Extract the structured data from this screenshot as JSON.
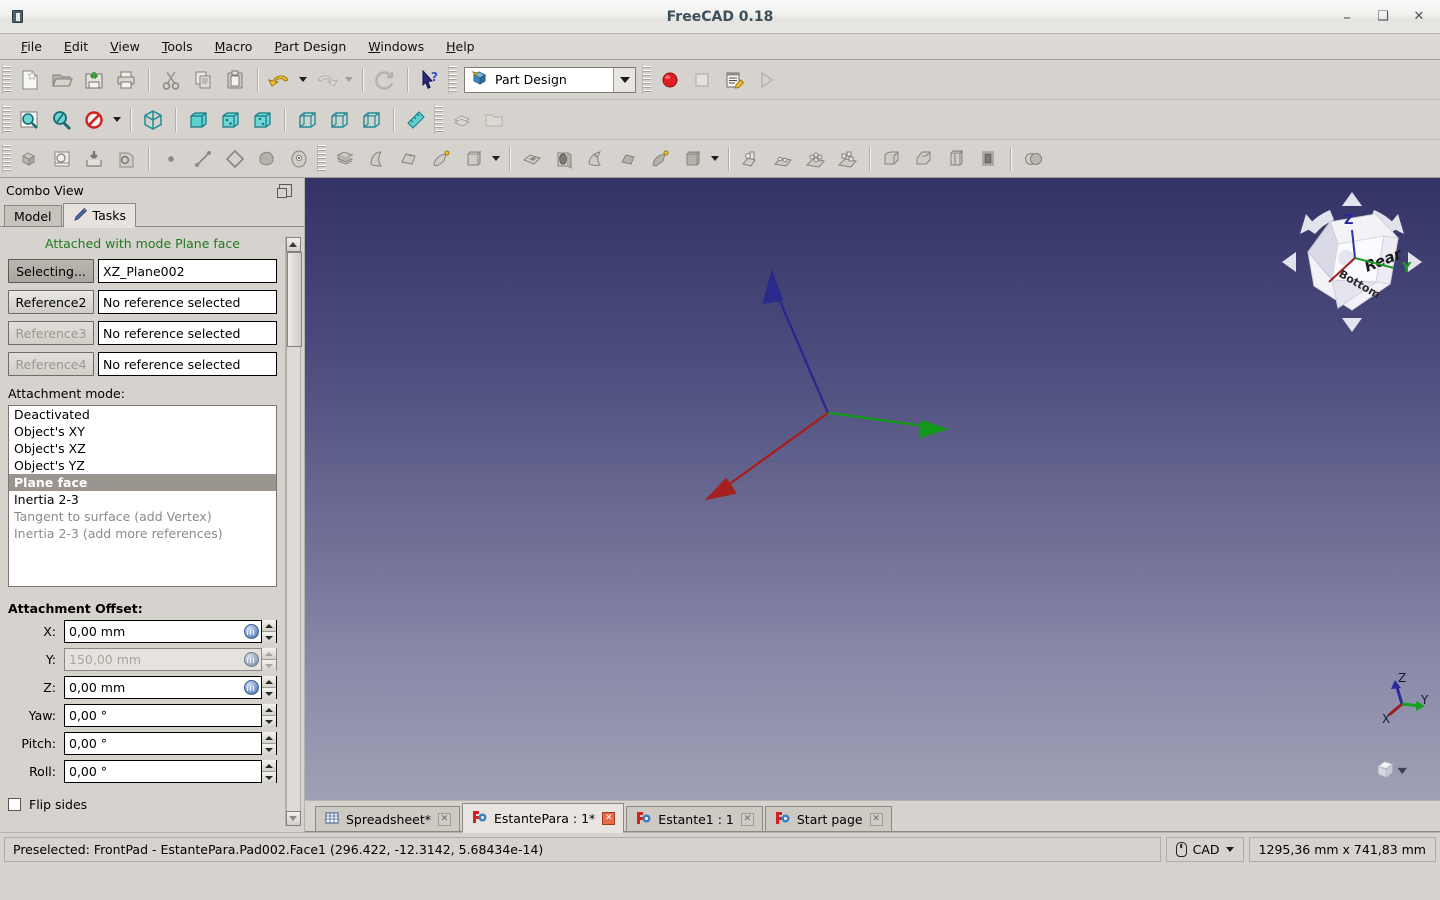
{
  "window": {
    "title": "FreeCAD 0.18",
    "minimize": "–",
    "maximize": "❑",
    "close": "✕",
    "app_icon": "freecad-icon"
  },
  "menubar": {
    "items": [
      {
        "label": "File",
        "accel": "F"
      },
      {
        "label": "Edit",
        "accel": "E"
      },
      {
        "label": "View",
        "accel": "V"
      },
      {
        "label": "Tools",
        "accel": "T"
      },
      {
        "label": "Macro",
        "accel": "M"
      },
      {
        "label": "Part Design",
        "accel": "P"
      },
      {
        "label": "Windows",
        "accel": "W"
      },
      {
        "label": "Help",
        "accel": "H"
      }
    ]
  },
  "toolbars": {
    "file": [
      "new-document-icon",
      "open-document-icon",
      "save-document-icon",
      "print-icon",
      "cut-icon",
      "copy-icon",
      "paste-icon",
      "undo-icon",
      "redo-icon",
      "refresh-icon",
      "whats-this-icon"
    ],
    "workbench": {
      "selected": "Part Design",
      "icon": "part-design-workbench-icon",
      "options": [
        "Part Design"
      ]
    },
    "macro": [
      "macro-record-icon",
      "macro-stop-icon",
      "macro-edit-icon",
      "macro-execute-icon"
    ],
    "view": [
      "fit-all-icon",
      "fit-selection-icon",
      "draw-style-icon",
      "isometric-view-icon",
      "front-view-icon",
      "top-view-icon",
      "right-view-icon",
      "rear-view-icon",
      "bottom-view-icon",
      "left-view-icon",
      "measure-icon",
      "appearance-icon",
      "folder-icon"
    ],
    "partdesign": [
      "create-body-icon",
      "create-sketch-icon",
      "attach-sketch-icon",
      "edit-sketch-icon",
      "point-icon",
      "line-icon",
      "plane-icon",
      "shapebinder-icon",
      "clone-icon",
      "pad-icon",
      "revolution-icon",
      "additive-loft-icon",
      "additive-pipe-icon",
      "additive-primitive-icon",
      "pocket-icon",
      "hole-icon",
      "groove-icon",
      "subtractive-loft-icon",
      "subtractive-pipe-icon",
      "subtractive-primitive-icon",
      "mirrored-icon",
      "linear-pattern-icon",
      "polar-pattern-icon",
      "multi-transform-icon",
      "fillet-icon",
      "chamfer-icon",
      "draft-icon",
      "thickness-icon",
      "boolean-icon"
    ]
  },
  "dock": {
    "title": "Combo View",
    "float_icon": "undock-icon",
    "tabs": [
      {
        "label": "Model",
        "icon": "model-tab-icon",
        "active": false
      },
      {
        "label": "Tasks",
        "icon": "pencil-icon",
        "active": true
      }
    ]
  },
  "task": {
    "attached_message": "Attached with mode Plane face",
    "attached_color": "#1f7a1f",
    "references": [
      {
        "button": "Selecting...",
        "value": "XZ_Plane002",
        "button_state": "pressed",
        "field_state": "filled"
      },
      {
        "button": "Reference2",
        "value": "No reference selected",
        "button_state": "normal",
        "field_state": "filled"
      },
      {
        "button": "Reference3",
        "value": "No reference selected",
        "button_state": "disabled",
        "field_state": "filled"
      },
      {
        "button": "Reference4",
        "value": "No reference selected",
        "button_state": "disabled",
        "field_state": "filled"
      }
    ],
    "mode_label": "Attachment mode:",
    "modes": [
      {
        "label": "Deactivated",
        "state": "normal"
      },
      {
        "label": "Object's XY",
        "state": "normal"
      },
      {
        "label": "Object's XZ",
        "state": "normal"
      },
      {
        "label": "Object's  YZ",
        "state": "normal"
      },
      {
        "label": "Plane face",
        "state": "selected"
      },
      {
        "label": "Inertia 2-3",
        "state": "normal"
      },
      {
        "label": "Tangent to surface (add Vertex)",
        "state": "disabled"
      },
      {
        "label": "Inertia 2-3 (add more references)",
        "state": "disabled"
      }
    ],
    "offset_label": "Attachment Offset:",
    "offsets": [
      {
        "label": "X:",
        "value": "0,00 mm",
        "state": "enabled",
        "unit_icon": true
      },
      {
        "label": "Y:",
        "value": "150,00 mm",
        "state": "disabled",
        "unit_icon": true
      },
      {
        "label": "Z:",
        "value": "0,00 mm",
        "state": "enabled",
        "unit_icon": true
      },
      {
        "label": "Yaw:",
        "value": "0,00 °",
        "state": "enabled",
        "unit_icon": false
      },
      {
        "label": "Pitch:",
        "value": "0,00 °",
        "state": "enabled",
        "unit_icon": false
      },
      {
        "label": "Roll:",
        "value": "0,00 °",
        "state": "enabled",
        "unit_icon": false
      }
    ],
    "flip_sides": {
      "label": "Flip sides",
      "checked": false
    }
  },
  "viewport": {
    "background_top": "#333366",
    "background_bottom": "#9f9fb4",
    "axes": [
      {
        "name": "x-axis",
        "color": "#b22222"
      },
      {
        "name": "y-axis",
        "color": "#11a011"
      },
      {
        "name": "z-axis",
        "color": "#2222aa"
      }
    ],
    "navcube": {
      "front_face_label": "Rear",
      "axis_labels": [
        "Z",
        "Y"
      ],
      "side_face_label": "Bottom"
    },
    "axis_cross": {
      "labels": [
        "Z",
        "Y",
        "X"
      ]
    }
  },
  "doc_tabs": [
    {
      "label": "Spreadsheet*",
      "icon": "spreadsheet-icon",
      "active": false,
      "close_state": "normal"
    },
    {
      "label": "EstantePara : 1*",
      "icon": "freecad-doc-icon",
      "active": true,
      "close_state": "modified"
    },
    {
      "label": "Estante1 : 1",
      "icon": "freecad-doc-icon",
      "active": false,
      "close_state": "normal"
    },
    {
      "label": "Start page",
      "icon": "freecad-doc-icon",
      "active": false,
      "close_state": "normal"
    }
  ],
  "statusbar": {
    "message": "Preselected: FrontPad - EstantePara.Pad002.Face1 (296.422, -12.3142, 5.68434e-14)",
    "nav_style": {
      "label": "CAD",
      "icon": "mouse-icon"
    },
    "dimensions": "1295,36 mm x 741,83 mm"
  }
}
